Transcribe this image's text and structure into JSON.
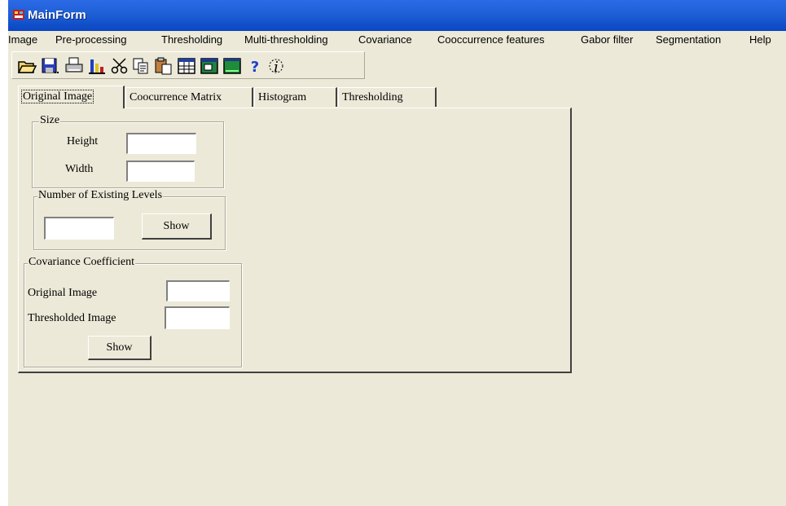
{
  "window": {
    "title": "MainForm"
  },
  "menu": [
    "Image",
    "Pre-processing",
    "Thresholding",
    "Multi-thresholding",
    "Covariance",
    "Cooccurrence features",
    "Gabor filter",
    "Segmentation",
    "Help"
  ],
  "toolbar": {
    "icons": [
      "open-folder-icon",
      "save-icon",
      "print-icon",
      "chart-icon",
      "cut-icon",
      "copy-icon",
      "paste-icon",
      "grid-icon",
      "window-icon",
      "screen-icon",
      "help-icon",
      "info-icon"
    ]
  },
  "tabs": [
    "Original Image",
    "Coocurrence Matrix",
    "Histogram",
    "Thresholding"
  ],
  "active_tab": "Original Image",
  "size_group": {
    "label": "Size",
    "height_label": "Height",
    "height_value": "",
    "width_label": "Width",
    "width_value": ""
  },
  "levels_group": {
    "label": "Number of Existing Levels",
    "value": "",
    "show_label": "Show"
  },
  "covariance_group": {
    "label": "Covariance Coefficient",
    "original_label": "Original Image",
    "original_value": "",
    "thresholded_label": "Thresholded Image",
    "thresholded_value": "",
    "show_label": "Show"
  }
}
